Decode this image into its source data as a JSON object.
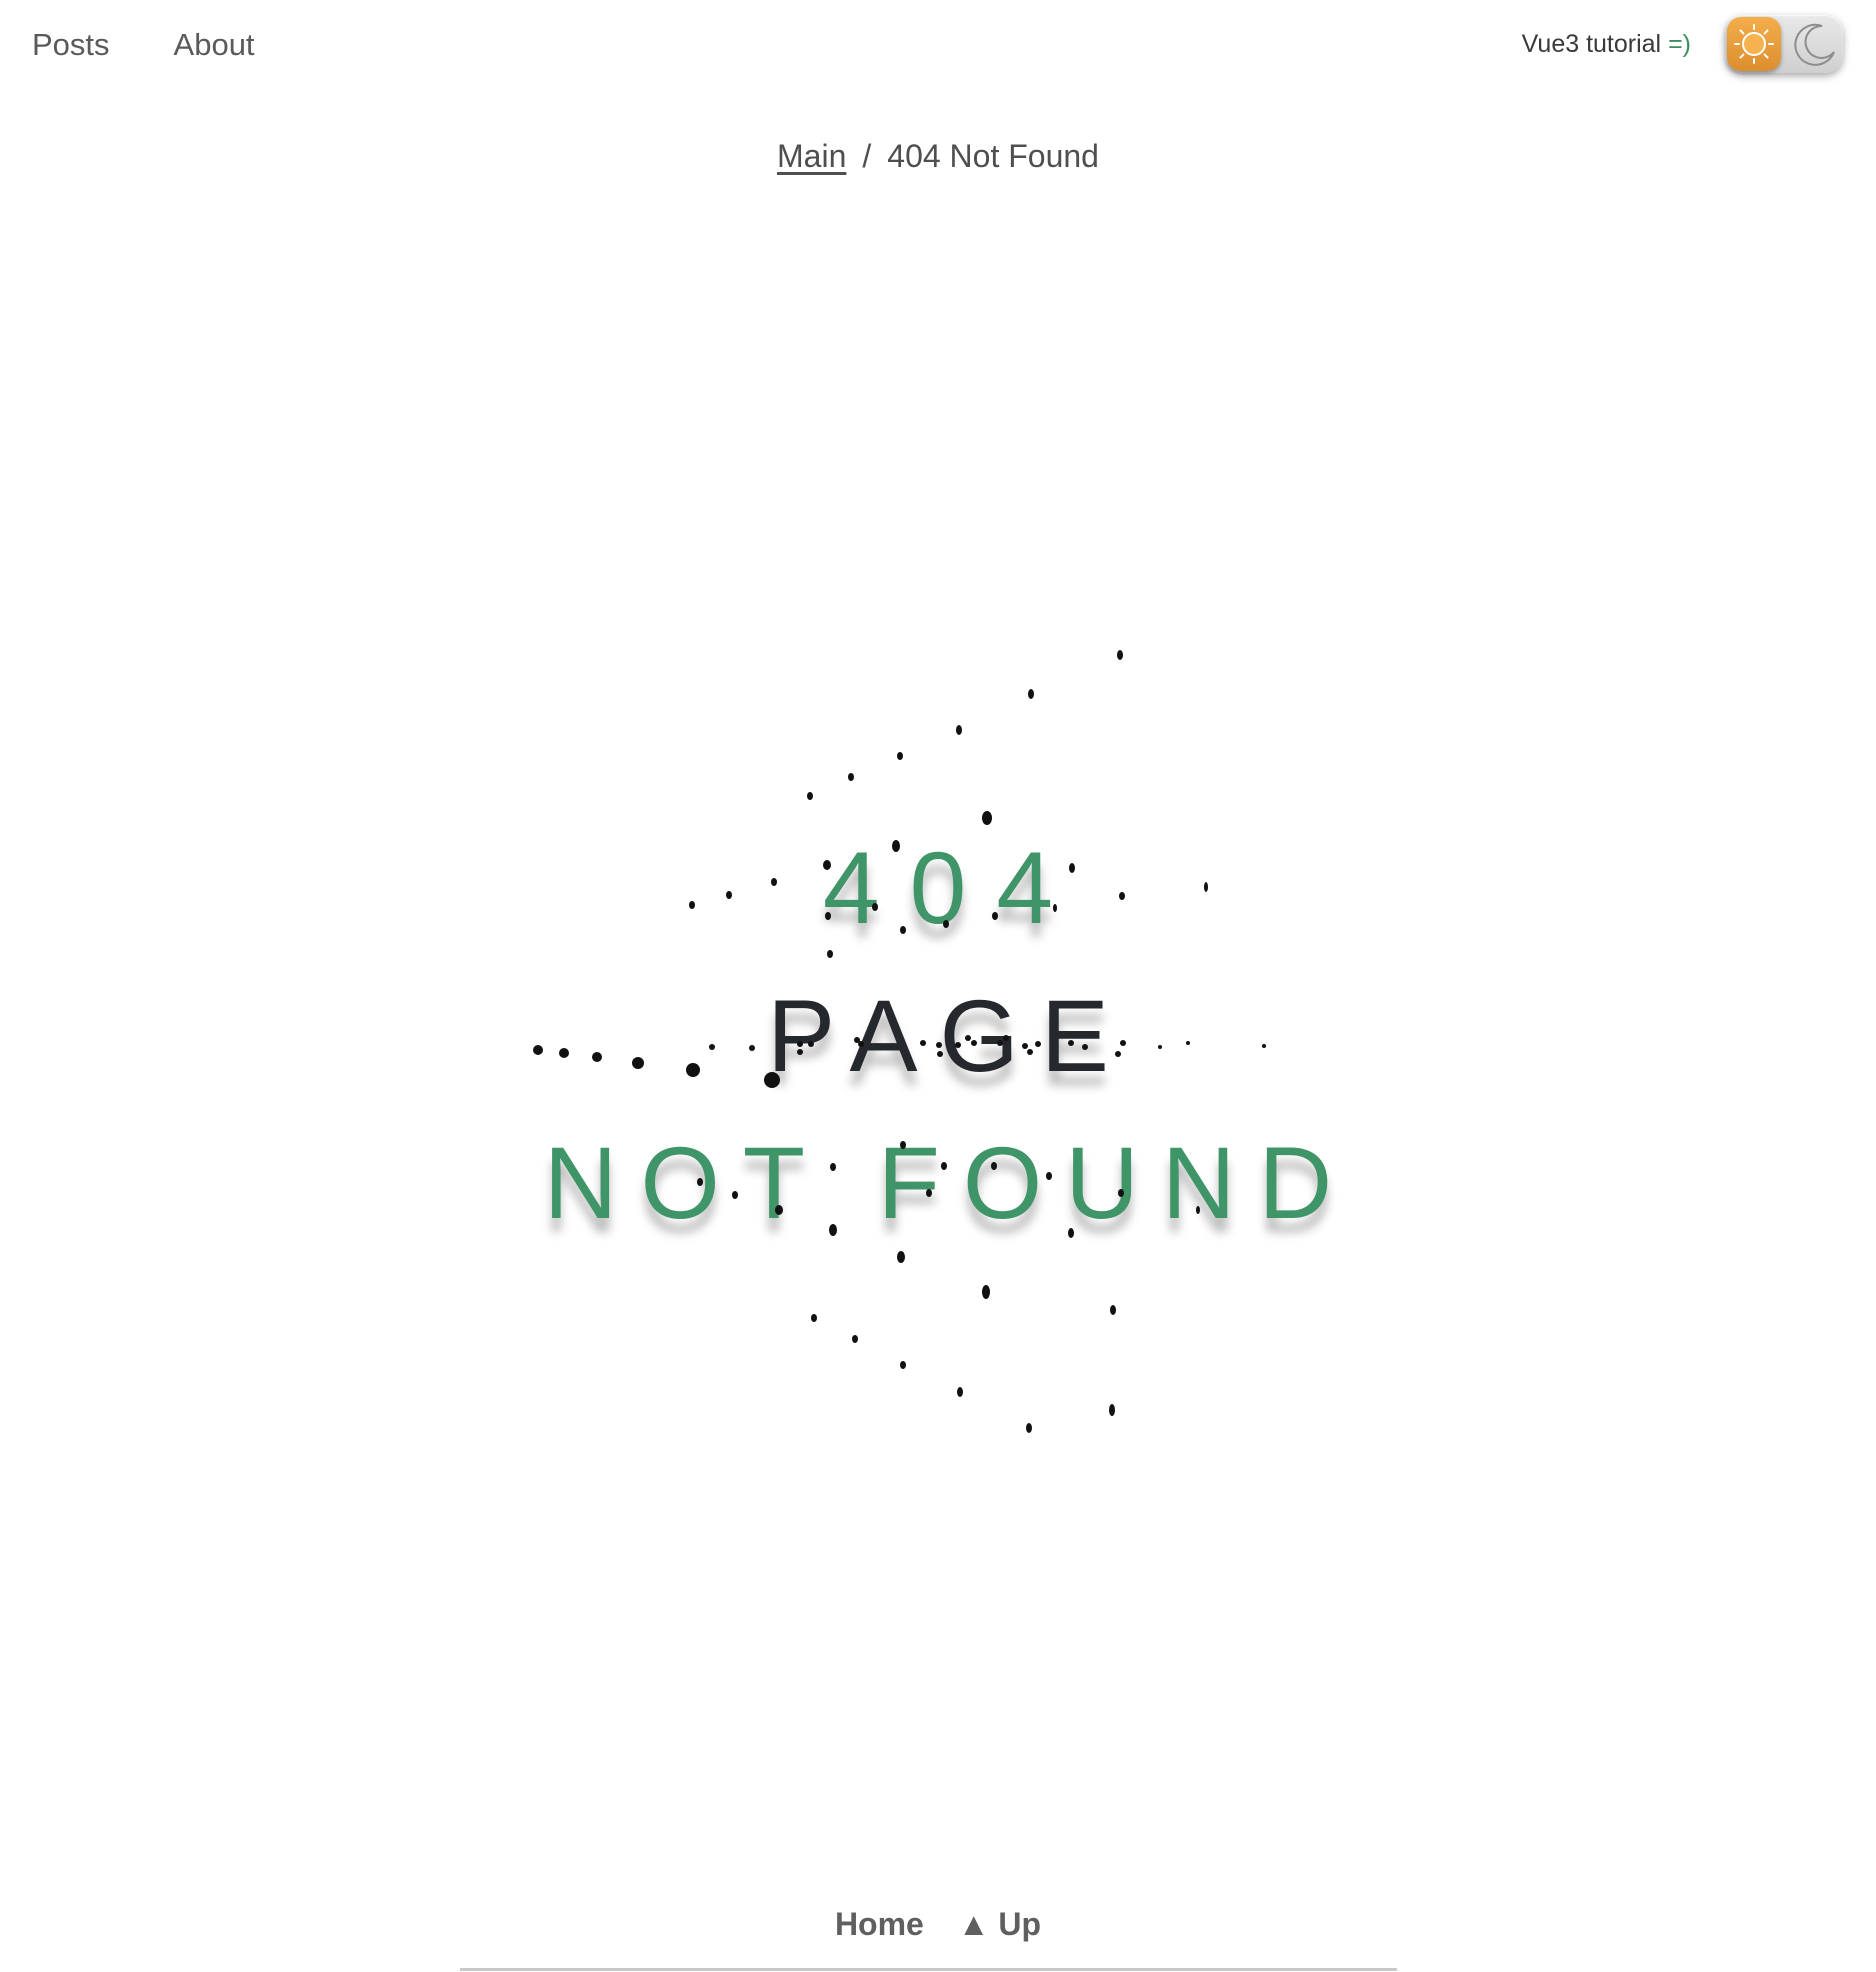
{
  "nav": {
    "items": [
      {
        "label": "Posts"
      },
      {
        "label": "About"
      }
    ],
    "brand_text": "Vue3 tutorial ",
    "brand_smile": "=)",
    "theme_toggle": {
      "state": "light",
      "light_icon": "sun-icon",
      "dark_icon": "moon-icon"
    }
  },
  "breadcrumb": {
    "home_label": "Main",
    "separator": "/",
    "current": "404 Not Found"
  },
  "error": {
    "code_text": "404",
    "line_page": "PAGE",
    "line_not_found": "NOT FOUND"
  },
  "footer": {
    "home_label": "Home",
    "up_label": "▲ Up"
  },
  "colors": {
    "accent": "#3f9468",
    "text_dark": "#25282c",
    "nav_text": "#5a5a5a",
    "toggle_sun": "#f0a443"
  }
}
